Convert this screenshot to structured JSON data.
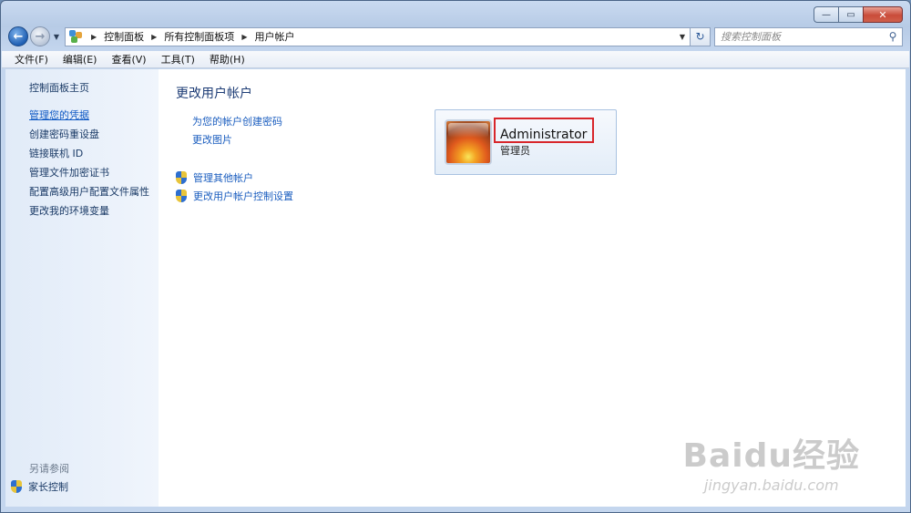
{
  "window": {
    "close_glyph": "✕",
    "minimize_glyph": "—",
    "maximize_glyph": "▭"
  },
  "address": {
    "crumbs": [
      "控制面板",
      "所有控制面板项",
      "用户帐户"
    ],
    "search_placeholder": "搜索控制面板"
  },
  "menu": [
    "文件(F)",
    "编辑(E)",
    "查看(V)",
    "工具(T)",
    "帮助(H)"
  ],
  "sidebar": {
    "home": "控制面板主页",
    "links": [
      "管理您的凭据",
      "创建密码重设盘",
      "链接联机 ID",
      "管理文件加密证书",
      "配置高级用户配置文件属性",
      "更改我的环境变量"
    ],
    "active_index": 0,
    "see_also": "另请参阅",
    "family": "家长控制"
  },
  "main": {
    "title": "更改用户帐户",
    "tasks": [
      "为您的帐户创建密码",
      "更改图片"
    ],
    "shield_tasks": [
      "管理其他帐户",
      "更改用户帐户控制设置"
    ]
  },
  "user": {
    "name": "Administrator",
    "role": "管理员"
  },
  "watermark": {
    "main": "Baidu经验",
    "sub": "jingyan.baidu.com"
  },
  "colors": {
    "link": "#1a5dbf",
    "highlight": "#d8262b",
    "title": "#1e3d76"
  },
  "icons": [
    "back-arrow-icon",
    "forward-arrow-icon",
    "control-panel-icon",
    "refresh-icon",
    "search-icon",
    "uac-shield-icon",
    "help-icon"
  ]
}
